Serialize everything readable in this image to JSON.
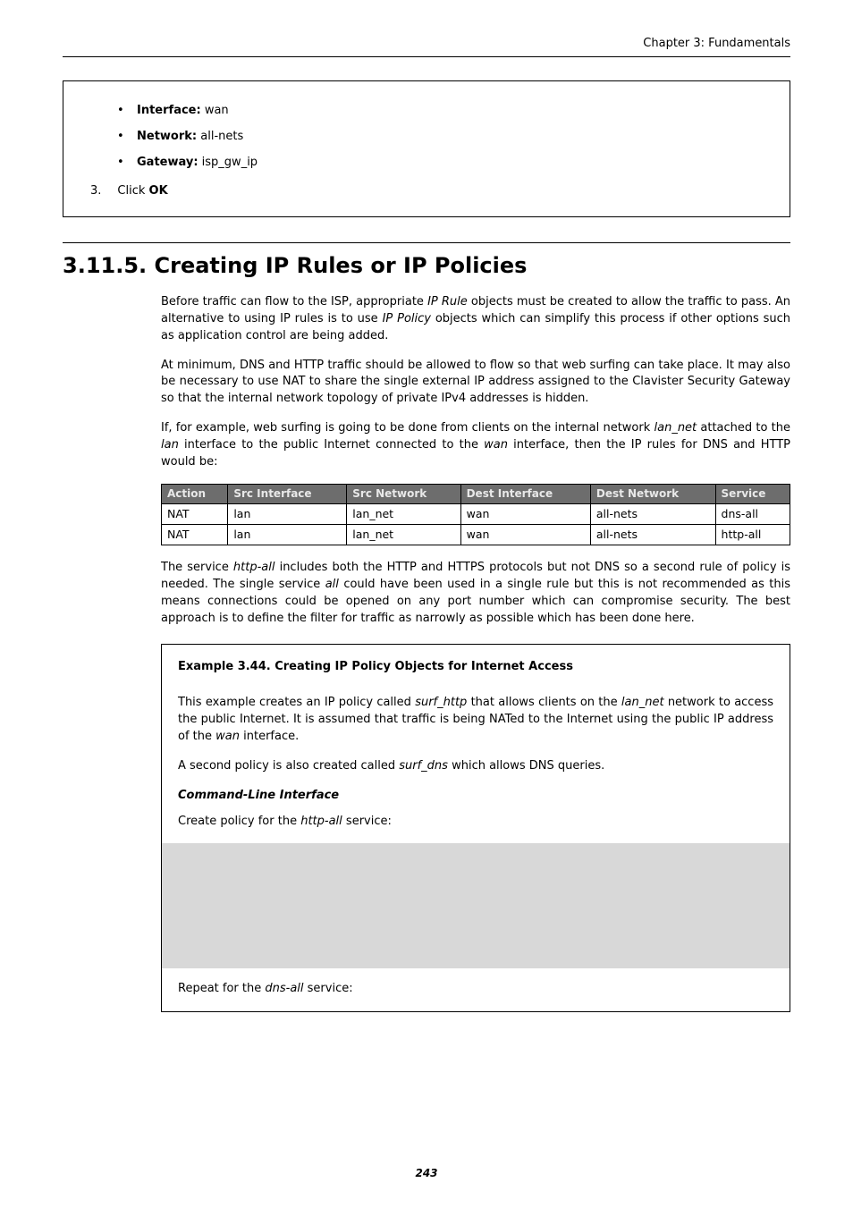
{
  "page": {
    "header_right": "Chapter 3: Fundamentals",
    "footer_page": "243"
  },
  "first_box": {
    "items": [
      {
        "label": "Interface:",
        "value": "wan"
      },
      {
        "label": "Network:",
        "value": "all-nets"
      },
      {
        "label": "Gateway:",
        "value": "isp_gw_ip"
      }
    ],
    "step_num": "3.",
    "step_text_prefix": "Click ",
    "step_text_bold": "OK"
  },
  "section": {
    "title": "3.11.5. Creating IP Rules or IP Policies",
    "para1_a": "Before traffic can flow to the ISP, appropriate ",
    "para1_i1": "IP Rule",
    "para1_b": " objects must be created to allow the traffic to pass. An alternative to using IP rules is to use ",
    "para1_i2": "IP Policy",
    "para1_c": " objects which can simplify this process if other options such as application control are being added.",
    "para2": "At minimum, DNS and HTTP traffic should be allowed to flow so that web surfing can take place. It may also be necessary to use NAT to share the single external IP address assigned to the Clavister Security Gateway so that the internal network topology of private IPv4 addresses is hidden.",
    "para3_a": "If, for example, web surfing is going to be done from clients on the internal network ",
    "para3_i1": "lan_net",
    "para3_b": " attached to the ",
    "para3_i2": "lan",
    "para3_c": " interface to the public Internet connected to the ",
    "para3_i3": "wan",
    "para3_d": " interface, then the IP rules for DNS and HTTP would be:",
    "para4_a": "The service ",
    "para4_i1": "http-all",
    "para4_b": " includes both the HTTP and HTTPS protocols but not DNS so a second rule of policy is needed. The single service ",
    "para4_i2": "all",
    "para4_c": " could have been used in a single rule but this is not recommended as this means connections could be opened on any port number which can compromise security. The best approach is to define the filter for traffic as narrowly as possible which has been done here."
  },
  "rules_table": {
    "headers": [
      "Action",
      "Src Interface",
      "Src Network",
      "Dest Interface",
      "Dest Network",
      "Service"
    ],
    "rows": [
      [
        "NAT",
        "lan",
        "lan_net",
        "wan",
        "all-nets",
        "dns-all"
      ],
      [
        "NAT",
        "lan",
        "lan_net",
        "wan",
        "all-nets",
        "http-all"
      ]
    ]
  },
  "example": {
    "title": "Example 3.44. Creating IP Policy Objects for Internet Access",
    "para1_a": "This example creates an IP policy called ",
    "para1_i1": "surf_http",
    "para1_b": " that allows clients on the ",
    "para1_i2": "lan_net",
    "para1_c": " network to access the public Internet. It is assumed that traffic is being NATed to the Internet using the public IP address of the ",
    "para1_i3": "wan",
    "para1_d": " interface.",
    "para2_a": "A second policy is also created called ",
    "para2_i1": "surf_dns",
    "para2_b": " which allows DNS queries.",
    "cli_heading": "Command-Line Interface",
    "cli_intro_a": "Create policy for the ",
    "cli_intro_i": "http-all",
    "cli_intro_b": " service:",
    "repeat_a": "Repeat for the ",
    "repeat_i": "dns-all",
    "repeat_b": " service:"
  }
}
